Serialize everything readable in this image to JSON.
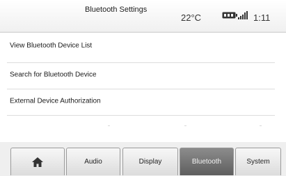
{
  "header": {
    "title": "Bluetooth Settings",
    "temperature": "22°C",
    "time": "1:11",
    "status_icons": [
      "battery-icon",
      "signal-icon"
    ]
  },
  "menu": {
    "items": [
      {
        "label": "View Bluetooth Device List"
      },
      {
        "label": "Search for Bluetooth Device"
      },
      {
        "label": "External Device Authorization"
      }
    ]
  },
  "tabs": {
    "home_icon": "home-icon",
    "items": [
      {
        "label": "Audio"
      },
      {
        "label": "Display"
      },
      {
        "label": "Bluetooth"
      },
      {
        "label": "System"
      }
    ],
    "active": "Bluetooth"
  },
  "colors": {
    "active_tab": "#6e6e6e",
    "tab_background": "#e8e8e8",
    "header_background": "#f4f4f4"
  }
}
